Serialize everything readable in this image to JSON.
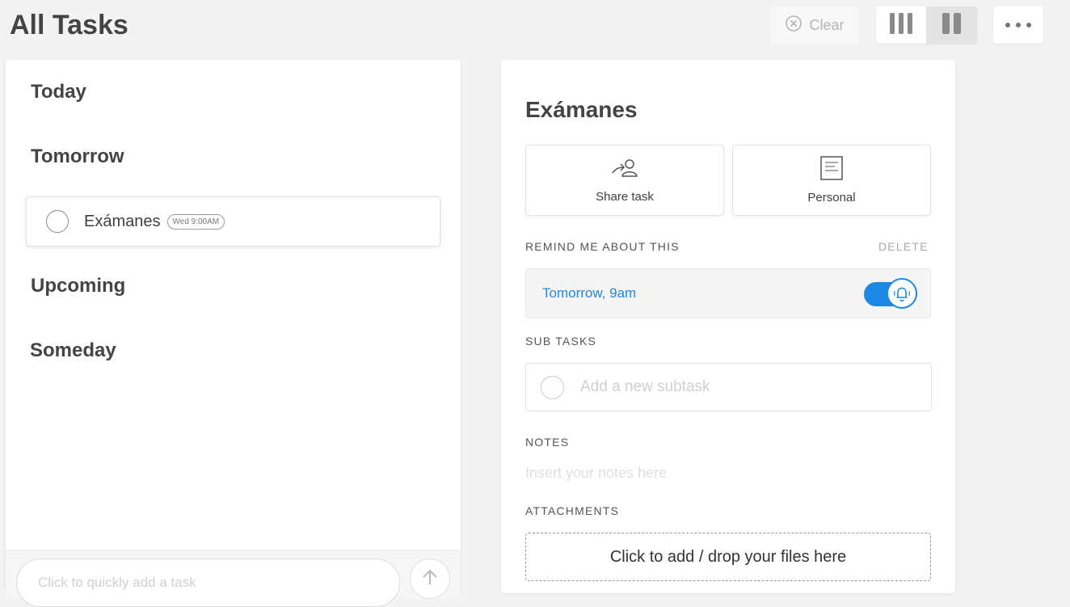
{
  "header": {
    "title": "All Tasks",
    "clear_label": "Clear"
  },
  "task_list": {
    "sections": {
      "today": "Today",
      "tomorrow": "Tomorrow",
      "upcoming": "Upcoming",
      "someday": "Someday"
    },
    "tasks": [
      {
        "name": "Exámanes",
        "badge": "Wed 9:00AM"
      }
    ],
    "quick_add_placeholder": "Click to quickly add a task"
  },
  "detail": {
    "title": "Exámanes",
    "share_label": "Share task",
    "list_label": "Personal",
    "remind_label": "REMIND ME ABOUT THIS",
    "delete_label": "DELETE",
    "reminder_value": "Tomorrow, 9am",
    "reminder_enabled": true,
    "subtasks_label": "SUB TASKS",
    "subtask_placeholder": "Add a new subtask",
    "notes_label": "NOTES",
    "notes_placeholder": "Insert your notes here",
    "attachments_label": "ATTACHMENTS",
    "attach_prompt": "Click to add / drop your files here"
  },
  "colors": {
    "accent": "#1e88e5",
    "background": "#f3f3f3",
    "text": "#404040"
  },
  "icons": [
    "clear-icon",
    "three-column-icon",
    "two-column-icon",
    "more-icon",
    "share-icon",
    "list-icon",
    "bell-icon",
    "arrow-up-icon"
  ]
}
